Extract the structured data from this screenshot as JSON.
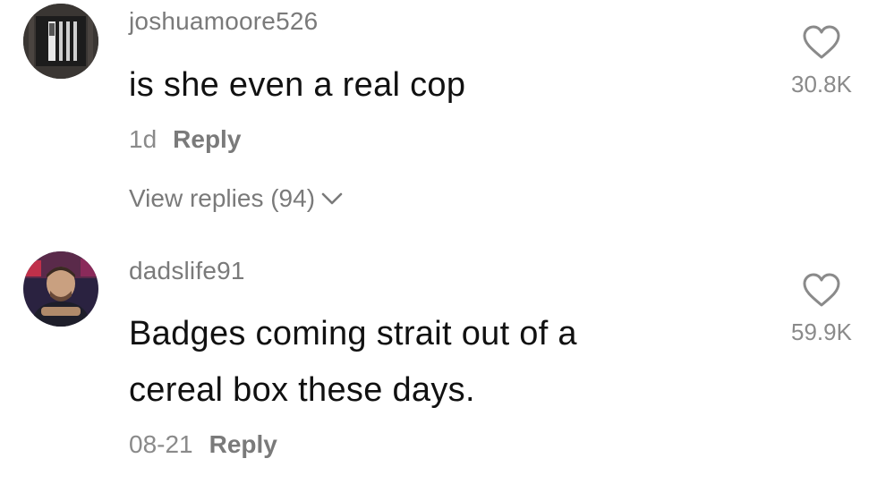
{
  "comments": [
    {
      "username": "joshuamoore526",
      "text": "is she even a real cop",
      "date": "1d",
      "reply_label": "Reply",
      "view_replies_label": "View replies (94)",
      "likes": "30.8K",
      "icons": {
        "like": "heart-outline-icon",
        "expand": "chevron-down-icon"
      }
    },
    {
      "username": "dadslife91",
      "text_line1": "Badges coming strait out of a",
      "text_line2": "cereal box these days.",
      "date": "08-21",
      "reply_label": "Reply",
      "likes": "59.9K",
      "icons": {
        "like": "heart-outline-icon"
      }
    }
  ],
  "colors": {
    "username": "#7a7a7a",
    "text": "#111111",
    "meta": "#8a8a8a",
    "background": "#ffffff"
  }
}
